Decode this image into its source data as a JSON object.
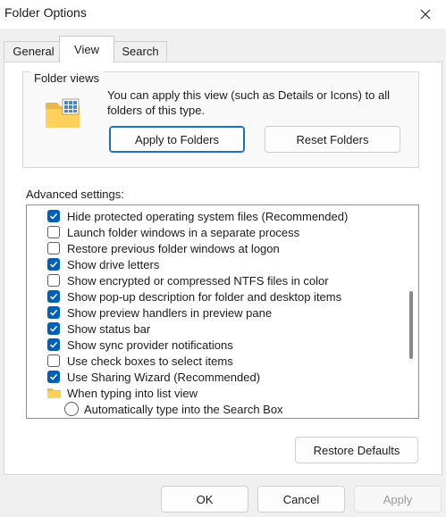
{
  "window": {
    "title": "Folder Options"
  },
  "tabs": [
    {
      "label": "General"
    },
    {
      "label": "View"
    },
    {
      "label": "Search"
    }
  ],
  "folder_views": {
    "legend": "Folder views",
    "description": "You can apply this view (such as Details or Icons) to all folders of this type.",
    "apply_button": "Apply to Folders",
    "reset_button": "Reset Folders"
  },
  "advanced": {
    "label": "Advanced settings:",
    "items": [
      {
        "type": "checkbox",
        "label": "Hide protected operating system files (Recommended)",
        "checked": true
      },
      {
        "type": "checkbox",
        "label": "Launch folder windows in a separate process",
        "checked": false
      },
      {
        "type": "checkbox",
        "label": "Restore previous folder windows at logon",
        "checked": false
      },
      {
        "type": "checkbox",
        "label": "Show drive letters",
        "checked": true
      },
      {
        "type": "checkbox",
        "label": "Show encrypted or compressed NTFS files in color",
        "checked": false
      },
      {
        "type": "checkbox",
        "label": "Show pop-up description for folder and desktop items",
        "checked": true
      },
      {
        "type": "checkbox",
        "label": "Show preview handlers in preview pane",
        "checked": true
      },
      {
        "type": "checkbox",
        "label": "Show status bar",
        "checked": true
      },
      {
        "type": "checkbox",
        "label": "Show sync provider notifications",
        "checked": true
      },
      {
        "type": "checkbox",
        "label": "Use check boxes to select items",
        "checked": false
      },
      {
        "type": "checkbox",
        "label": "Use Sharing Wizard (Recommended)",
        "checked": true
      },
      {
        "type": "folder",
        "label": "When typing into list view"
      },
      {
        "type": "radio",
        "label": "Automatically type into the Search Box",
        "checked": false
      }
    ]
  },
  "restore_defaults": "Restore Defaults",
  "footer": {
    "ok": "OK",
    "cancel": "Cancel",
    "apply": "Apply"
  },
  "colors": {
    "accent": "#005fb8",
    "window_bg": "#f0f0f0",
    "panel_bg": "#ffffff"
  }
}
